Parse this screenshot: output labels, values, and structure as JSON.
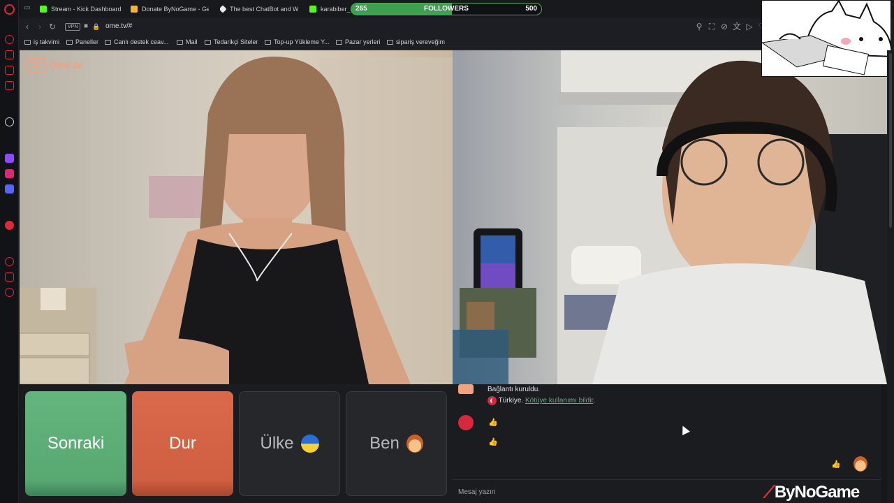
{
  "tabs": [
    {
      "label": "Stream - Kick Dashboard",
      "icon": "kick-icon"
    },
    {
      "label": "Donate ByNoGame - Gek",
      "icon": "bynogame-icon"
    },
    {
      "label": "The best ChatBot and W",
      "icon": "chatgpt-icon"
    },
    {
      "label": "karabiber_2",
      "icon": "kick-icon"
    }
  ],
  "followers": {
    "current": "265",
    "label": "FOLLOWERS",
    "goal": "500",
    "progress_fraction": 0.53
  },
  "address": {
    "vpn_label": "VPN",
    "url": "ome.tv/#"
  },
  "bookmarks": [
    "iş takvimi",
    "Paneller",
    "Canlı destek ceav...",
    "Mail",
    "Tedarikçi Siteler",
    "Top-up Yükleme Y...",
    "Pazar yerleri",
    "sipariş vereveğim"
  ],
  "logo": {
    "box_text": "Ome TV",
    "text": "Ome.tv"
  },
  "controls": {
    "next_label": "Sonraki",
    "stop_label": "Dur",
    "country_label": "Ülke",
    "me_label": "Ben"
  },
  "chat": {
    "connected": "Bağlantı kuruldu.",
    "country": "Türkiye.",
    "report_link": "Kötüye kullanımı bildir",
    "placeholder": "Mesaj yazın"
  },
  "branding": {
    "bynogame": "ByNoGame"
  },
  "colors": {
    "next": "#58a872",
    "stop": "#cf5f41",
    "accent_green": "#59b27a",
    "kick_green": "#53fc18",
    "opera_red": "#e0283a"
  }
}
